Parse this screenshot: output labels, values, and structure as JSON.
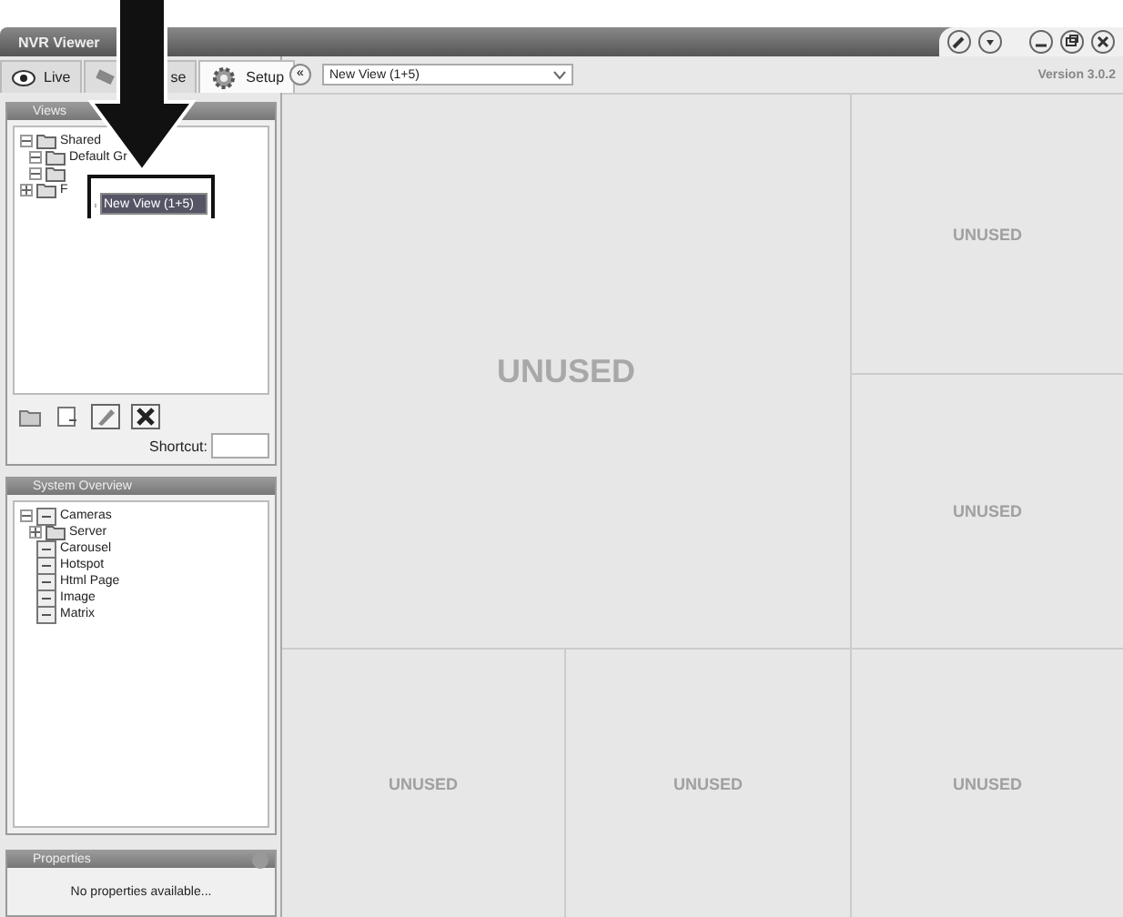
{
  "window": {
    "title": "NVR Viewer",
    "version": "Version 3.0.2"
  },
  "tabs": [
    {
      "label": "Live",
      "selected": false
    },
    {
      "label": "se",
      "selected": false
    },
    {
      "label": "Setup",
      "selected": true
    }
  ],
  "toolbar": {
    "back": "«",
    "view_select": "New View (1+5)"
  },
  "views_panel": {
    "title": "Views",
    "tree": [
      {
        "label": "Shared",
        "expanded": true,
        "children": [
          {
            "label": "Default Gr",
            "expanded": true
          },
          {
            "expanded": true
          }
        ]
      },
      {
        "label": "F",
        "expanded": false
      }
    ],
    "rename_value": "New View (1+5)",
    "shortcut_label": "Shortcut:"
  },
  "system_overview": {
    "title": "System Overview",
    "tree": [
      {
        "label": "Cameras",
        "expanded": true,
        "children": [
          {
            "label": "Server",
            "expanded": false
          }
        ]
      },
      {
        "label": "Carousel"
      },
      {
        "label": "Hotspot"
      },
      {
        "label": "Html Page"
      },
      {
        "label": "Image"
      },
      {
        "label": "Matrix"
      }
    ]
  },
  "properties": {
    "title": "Properties",
    "message": "No properties available..."
  },
  "cells": [
    {
      "label": "UNUSED",
      "kind": "big"
    },
    {
      "label": "UNUSED",
      "kind": "small"
    },
    {
      "label": "UNUSED",
      "kind": "small"
    },
    {
      "label": "UNUSED",
      "kind": "small"
    },
    {
      "label": "UNUSED",
      "kind": "small"
    },
    {
      "label": "UNUSED",
      "kind": "small"
    }
  ]
}
